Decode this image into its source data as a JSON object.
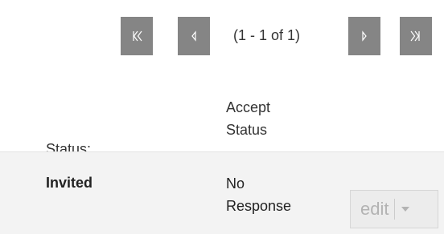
{
  "pagination": {
    "summary": "(1 - 1 of 1)",
    "first_icon": "first-page-icon",
    "prev_icon": "previous-page-icon",
    "next_icon": "next-page-icon",
    "last_icon": "last-page-icon",
    "button_color": "#858585"
  },
  "table": {
    "columns": [
      "Status:",
      "Accept Status"
    ],
    "column_accept_lines": [
      "Accept",
      "Status"
    ],
    "rows": [
      {
        "status": "Invited",
        "accept_status_lines": [
          "No",
          "Response"
        ],
        "action_label": "edit",
        "action_icon": "dropdown-caret-icon"
      }
    ]
  }
}
